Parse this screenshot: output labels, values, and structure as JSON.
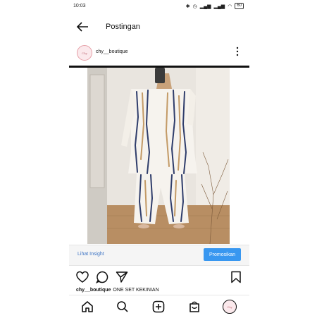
{
  "status_bar": {
    "time": "10:03",
    "battery": "60"
  },
  "app_bar": {
    "title": "Postingan"
  },
  "post": {
    "username": "chy__boutique",
    "avatar_text": "Chy",
    "insight_link": "Lihat Insight",
    "promote_button": "Promosikan",
    "caption_user": "chy__boutique",
    "caption_text": "ONE SET KEKINIAN"
  },
  "bottom_nav": {
    "avatar_text": "Chy"
  },
  "colors": {
    "link": "#3d74c4",
    "promote": "#3897f0",
    "avatar_ring": "#e6a0a8"
  },
  "icons": [
    "back-arrow-icon",
    "more-vertical-icon",
    "heart-icon",
    "comment-icon",
    "share-icon",
    "bookmark-icon",
    "home-icon",
    "search-icon",
    "add-post-icon",
    "shop-icon"
  ]
}
